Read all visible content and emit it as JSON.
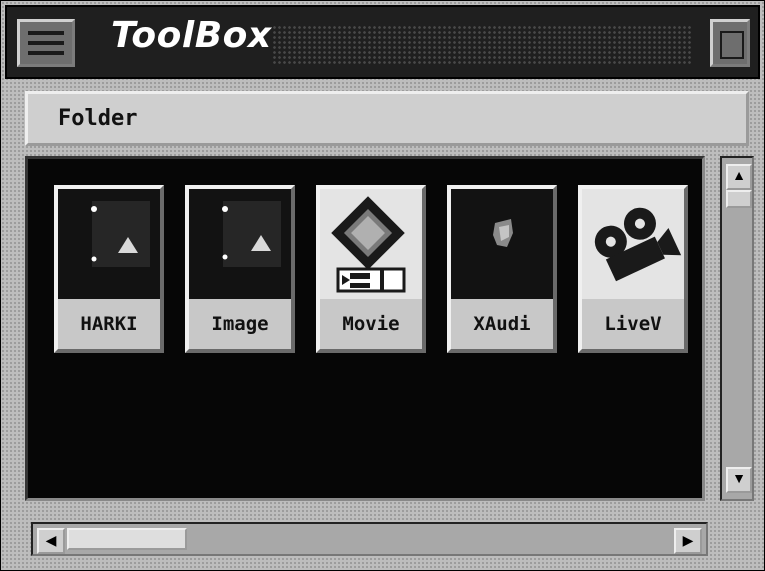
{
  "window": {
    "title": "ToolBox",
    "header_label": "Folder"
  },
  "tiles": [
    {
      "label": "HARKI",
      "icon": "image-placeholder-icon"
    },
    {
      "label": "Image",
      "icon": "image-placeholder-icon"
    },
    {
      "label": "Movie",
      "icon": "film-strip-icon"
    },
    {
      "label": "XAudi",
      "icon": "audio-icon"
    },
    {
      "label": "LiveV",
      "icon": "movie-camera-icon"
    }
  ],
  "scrollbars": {
    "up_arrow": "▲",
    "down_arrow": "▼",
    "left_arrow": "◀",
    "right_arrow": "▶"
  },
  "colors": {
    "window_bg": "#bdbdbd",
    "titlebar_bg": "#1f1f1f",
    "title_text": "#ffffff",
    "pane_bg": "#060606",
    "tile_label_bg": "#c8c8c8"
  }
}
